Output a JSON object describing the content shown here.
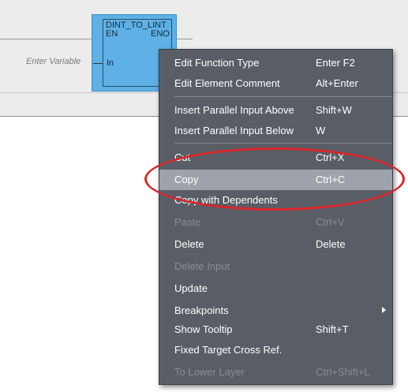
{
  "editor": {
    "function_block": {
      "name": "DINT_TO_LINT",
      "pin_en": "EN",
      "pin_eno": "ENO",
      "pin_in": "In"
    },
    "input_placeholder": "Enter Variable"
  },
  "context_menu": {
    "items": [
      {
        "label": "Edit Function Type",
        "shortcut": "Enter F2",
        "enabled": true
      },
      {
        "label": "Edit Element Comment",
        "shortcut": "Alt+Enter",
        "enabled": true
      },
      {
        "label": "Insert Parallel Input Above",
        "shortcut": "Shift+W",
        "enabled": true
      },
      {
        "label": "Insert Parallel Input Below",
        "shortcut": "W",
        "enabled": true
      },
      {
        "label": "Cut",
        "shortcut": "Ctrl+X",
        "enabled": true
      },
      {
        "label": "Copy",
        "shortcut": "Ctrl+C",
        "enabled": true,
        "highlighted": true
      },
      {
        "label": "Copy with Dependents",
        "shortcut": "",
        "enabled": true
      },
      {
        "label": "Paste",
        "shortcut": "Ctrl+V",
        "enabled": false
      },
      {
        "label": "Delete",
        "shortcut": "Delete",
        "enabled": true
      },
      {
        "label": "Delete Input",
        "shortcut": "",
        "enabled": false
      },
      {
        "label": "Update",
        "shortcut": "",
        "enabled": true
      },
      {
        "label": "Breakpoints",
        "shortcut": "",
        "enabled": true,
        "submenu": true
      },
      {
        "label": "Show Tooltip",
        "shortcut": "Shift+T",
        "enabled": true
      },
      {
        "label": "Fixed Target Cross Ref.",
        "shortcut": "",
        "enabled": true
      },
      {
        "label": "To Lower Layer",
        "shortcut": "Ctrl+Shift+L",
        "enabled": false
      }
    ]
  },
  "colors": {
    "menu_background": "#585d66",
    "menu_highlight": "#9ea3ab",
    "function_block": "#5eb0e5",
    "annotation": "#d8262b"
  }
}
